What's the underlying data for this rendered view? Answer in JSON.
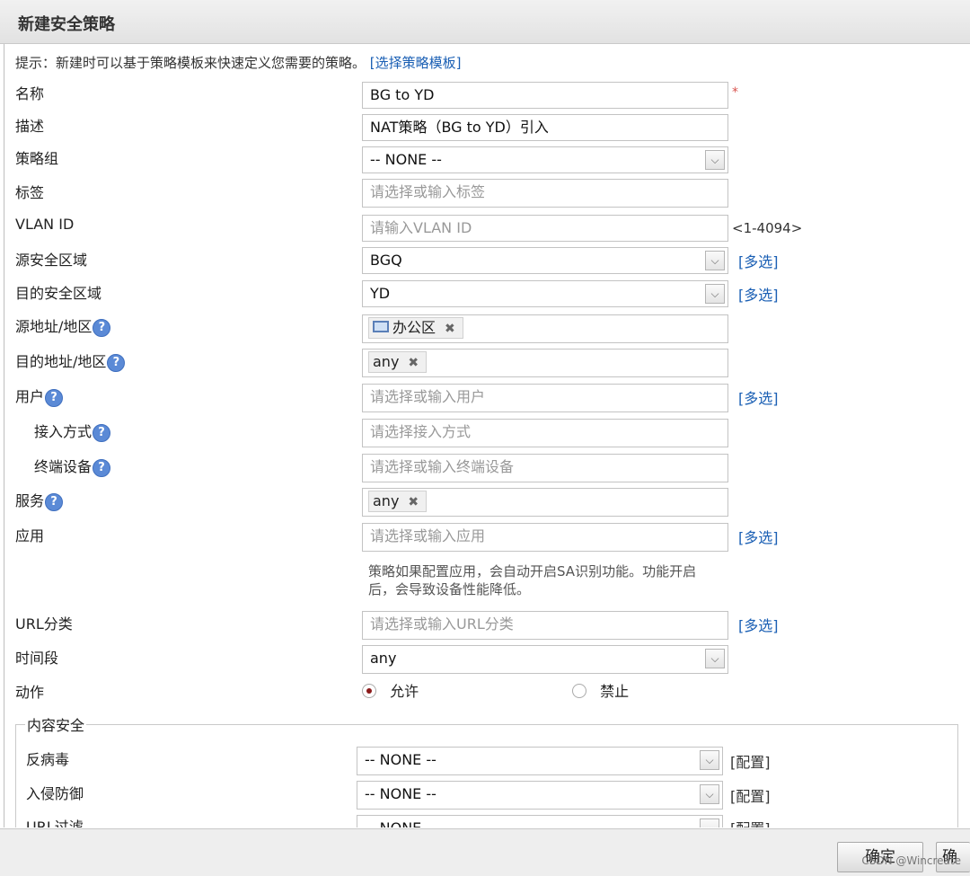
{
  "dialog": {
    "title": "新建安全策略"
  },
  "hint": {
    "text": "提示：新建时可以基于策略模板来快速定义您需要的策略。",
    "link": "[选择策略模板]"
  },
  "fields": {
    "name": {
      "label": "名称",
      "value": "BG to YD",
      "required_mark": "*"
    },
    "description": {
      "label": "描述",
      "value": "NAT策略（BG to YD）引入"
    },
    "policy_group": {
      "label": "策略组",
      "value": "-- NONE --"
    },
    "tag": {
      "label": "标签",
      "placeholder": "请选择或输入标签"
    },
    "vlan": {
      "label": "VLAN ID",
      "placeholder": "请输入VLAN ID",
      "range": "<1-4094>"
    },
    "src_zone": {
      "label": "源安全区域",
      "value": "BGQ",
      "multi": "[多选]"
    },
    "dst_zone": {
      "label": "目的安全区域",
      "value": "YD",
      "multi": "[多选]"
    },
    "src_addr": {
      "label": "源地址/地区",
      "tag": "办公区"
    },
    "dst_addr": {
      "label": "目的地址/地区",
      "tag": "any"
    },
    "user": {
      "label": "用户",
      "placeholder": "请选择或输入用户",
      "multi": "[多选]"
    },
    "access_method": {
      "label": "接入方式",
      "placeholder": "请选择接入方式"
    },
    "terminal_device": {
      "label": "终端设备",
      "placeholder": "请选择或输入终端设备"
    },
    "service": {
      "label": "服务",
      "tag": "any"
    },
    "application": {
      "label": "应用",
      "placeholder": "请选择或输入应用",
      "multi": "[多选]",
      "note_line1": "策略如果配置应用，会自动开启SA识别功能。功能开启",
      "note_line2": "后，会导致设备性能降低。"
    },
    "url_category": {
      "label": "URL分类",
      "placeholder": "请选择或输入URL分类",
      "multi": "[多选]"
    },
    "time_range": {
      "label": "时间段",
      "value": "any"
    },
    "action": {
      "label": "动作",
      "allow": "允许",
      "deny": "禁止",
      "selected": "允许"
    }
  },
  "content_security": {
    "legend": "内容安全",
    "antivirus": {
      "label": "反病毒",
      "value": "-- NONE --",
      "config": "[配置]"
    },
    "ips": {
      "label": "入侵防御",
      "value": "-- NONE --",
      "config": "[配置]"
    },
    "url_filter": {
      "label": "URL过滤",
      "value": "-- NONE --",
      "config": "[配置]"
    }
  },
  "footer": {
    "ok_label": "确定",
    "ok2_label": "确定",
    "watermark": "CSDN @Wincreate"
  },
  "icons": {
    "help": "help-icon",
    "remove": "remove-tag-icon",
    "pc": "pc-icon",
    "dropdown": "chevron-down-icon"
  },
  "colors": {
    "link": "#1a5fb4",
    "required": "#d9534f",
    "help_icon": "#5b8ad6"
  }
}
